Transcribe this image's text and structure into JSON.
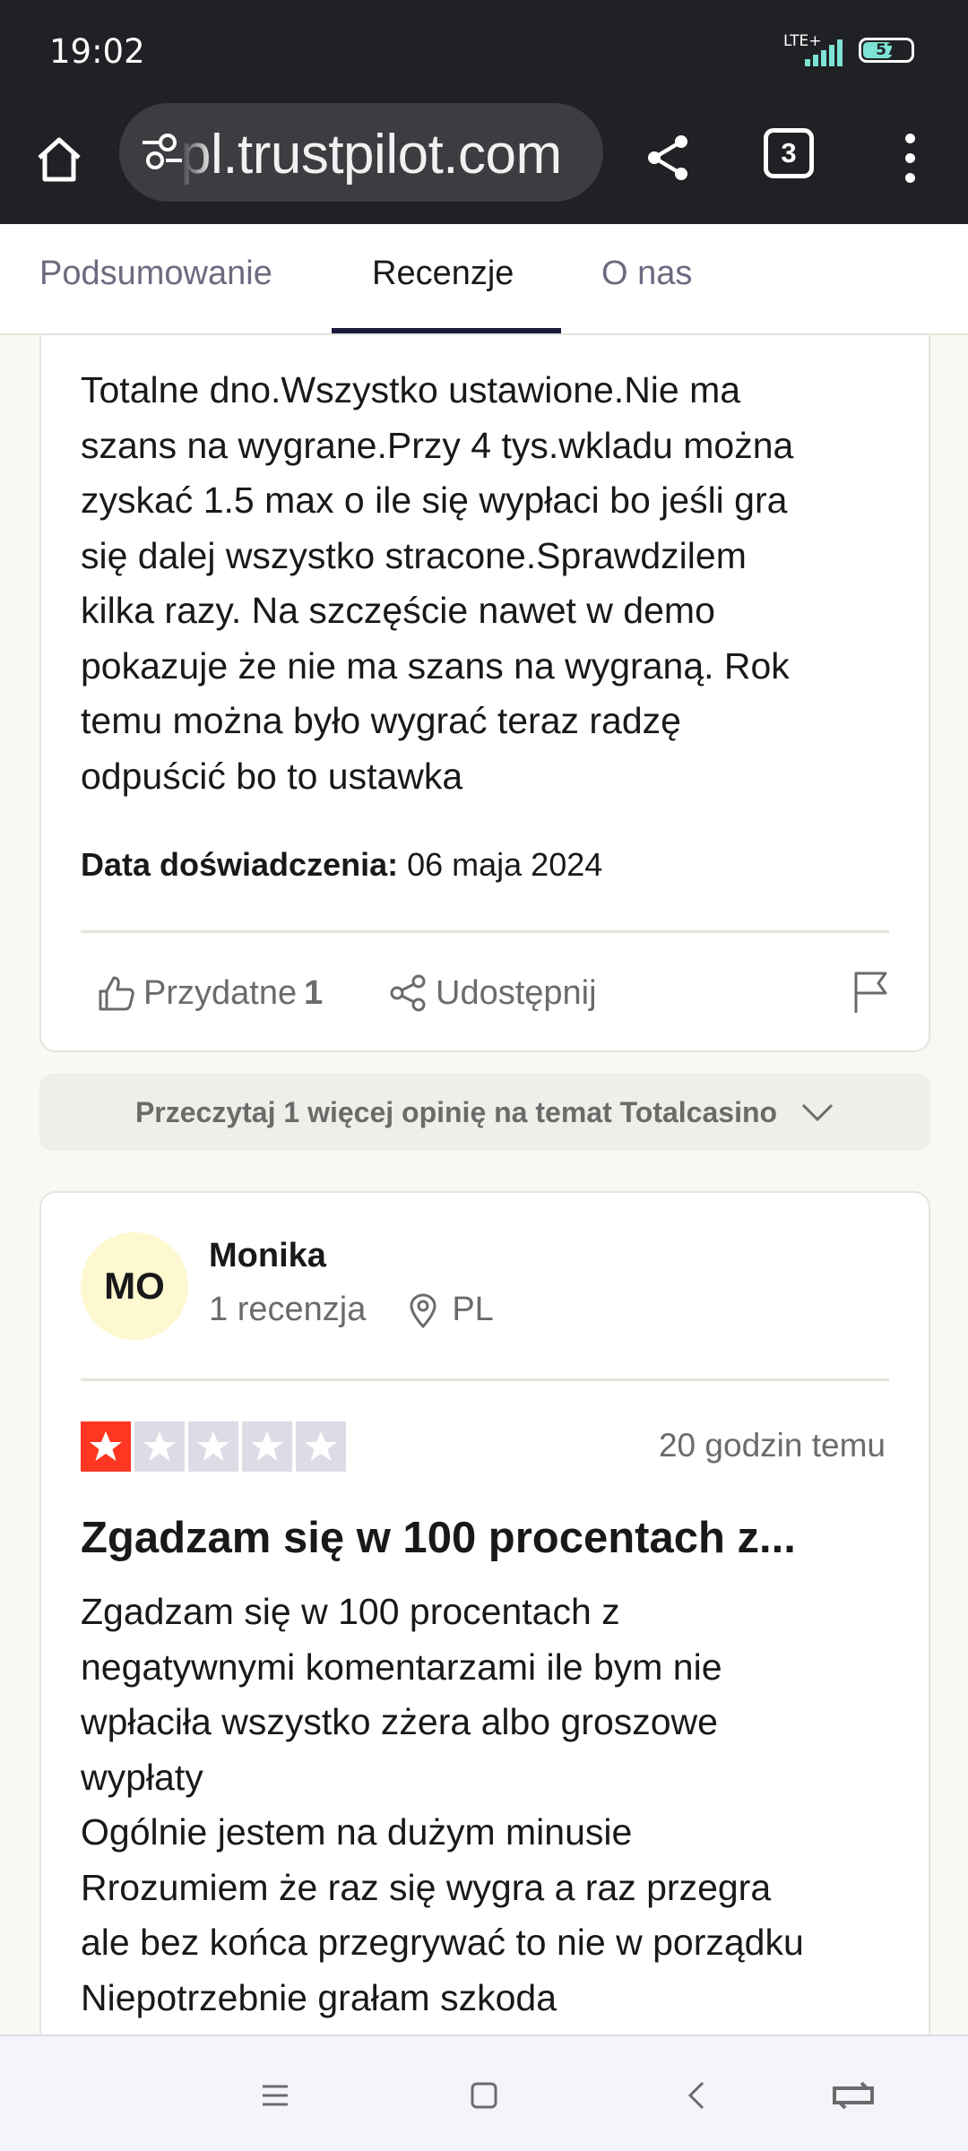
{
  "status_bar": {
    "time": "19:02",
    "network": "LTE+",
    "battery": "57"
  },
  "browser": {
    "url": "pl.trustpilot.com",
    "tab_count": "3"
  },
  "tabs": [
    {
      "label": "Podsumowanie"
    },
    {
      "label": "Recenzje",
      "active": true
    },
    {
      "label": "O nas"
    }
  ],
  "review1": {
    "body": "Totalne dno.Wszystko ustawione.Nie ma\nszans na wygrane.Przy 4 tys.wkladu można\nzyskać 1.5 max o ile się wypłaci bo jeśli gra\nsię dalej wszystko stracone.Sprawdzilem\nkilka razy. Na szczęście nawet w demo\npokazuje że nie ma szans na wygraną. Rok\ntemu można było wygrać teraz radzę\nodpuścić bo to ustawka",
    "experience_label": "Data doświadczenia:",
    "experience_date": "06 maja 2024",
    "useful_label": "Przydatne",
    "useful_count": "1",
    "share_label": "Udostępnij"
  },
  "more_reviews": {
    "label": "Przeczytaj 1 więcej opinię na temat Totalcasino"
  },
  "review2": {
    "avatar_initials": "MO",
    "name": "Monika",
    "review_count": "1 recenzja",
    "country": "PL",
    "rating": 1,
    "rating_max": 5,
    "date": "20 godzin temu",
    "title": "Zgadzam się w 100 procentach z...",
    "body": "Zgadzam się w 100 procentach z\nnegatywnymi komentarzami ile bym nie\nwpłaciła wszystko zżera albo groszowe\nwypłaty\nOgólnie jestem na dużym minusie\nRrozumiem że raz się wygra a raz przegra\nale bez końca przegrywać to nie w porządku\nNiepotrzebnie grałam szkoda"
  },
  "colors": {
    "star_red": "#ff3722",
    "star_empty": "#dcdce6",
    "avatar_bg": "#fdf8cf",
    "tab_underline": "#1c1c3c"
  }
}
